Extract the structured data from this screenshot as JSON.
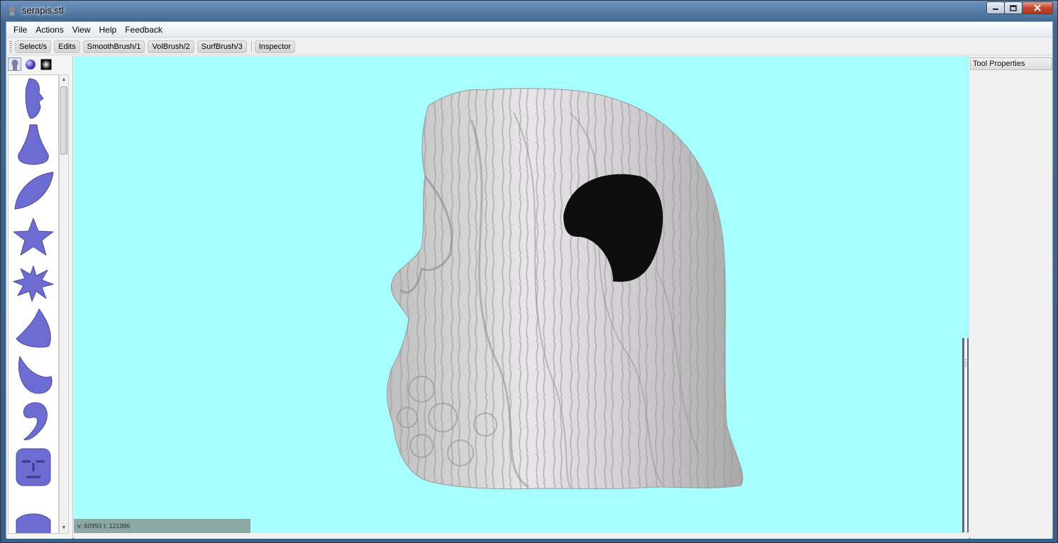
{
  "window": {
    "title": "serapis.stl",
    "colors": {
      "viewport_bg": "#a6feff",
      "model": "#d8d6d8",
      "tool_shapes": "#6c6cd2"
    }
  },
  "menubar": {
    "items": [
      "File",
      "Actions",
      "View",
      "Help",
      "Feedback"
    ]
  },
  "toolbar": {
    "buttons": [
      "Select/s",
      "Edits",
      "SmoothBrush/1",
      "VolBrush/2",
      "SurfBrush/3"
    ],
    "inspector": "Inspector"
  },
  "palette": {
    "tabs": [
      "head-icon",
      "sphere-icon",
      "gradient-square-icon"
    ],
    "shapes": [
      "face-icon",
      "nose-icon",
      "leaf-icon",
      "star-icon",
      "splat-icon",
      "crescent-icon",
      "horn-icon",
      "hook-icon",
      "mask-face-icon",
      "dome-icon"
    ]
  },
  "viewport": {
    "stats": "v: 60993  t: 121986"
  },
  "properties": {
    "header": "Tool Properties"
  }
}
